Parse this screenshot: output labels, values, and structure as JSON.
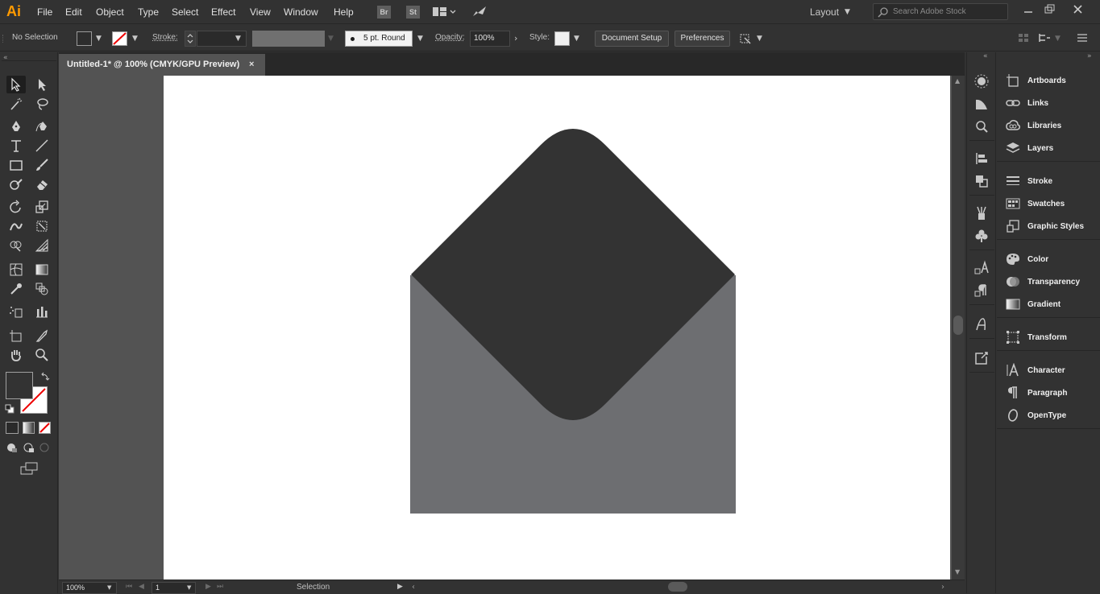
{
  "app": {
    "logo": "Ai"
  },
  "menu": [
    "File",
    "Edit",
    "Object",
    "Type",
    "Select",
    "Effect",
    "View",
    "Window",
    "Help"
  ],
  "menubar_badges": {
    "bridge": "Br",
    "stock": "St"
  },
  "workspace": {
    "label": "Layout"
  },
  "search": {
    "placeholder": "Search Adobe Stock"
  },
  "control": {
    "selection_status": "No Selection",
    "stroke_label": "Stroke:",
    "brush_label": "5 pt. Round",
    "opacity_label": "Opacity:",
    "opacity_value": "100%",
    "style_label": "Style:",
    "document_setup": "Document Setup",
    "preferences": "Preferences"
  },
  "document": {
    "tab_title": "Untitled-1* @ 100% (CMYK/GPU Preview)",
    "close": "×"
  },
  "status": {
    "zoom": "100%",
    "artboard_number": "1",
    "tool_name": "Selection"
  },
  "panels": [
    "Artboards",
    "Links",
    "Libraries",
    "Layers",
    "Stroke",
    "Swatches",
    "Graphic Styles",
    "Color",
    "Transparency",
    "Gradient",
    "Transform",
    "Character",
    "Paragraph",
    "OpenType"
  ],
  "colors": {
    "envelope_flap": "#333333",
    "envelope_body": "#6d6e71",
    "artboard": "#ffffff",
    "accent": "#ff9a00"
  }
}
